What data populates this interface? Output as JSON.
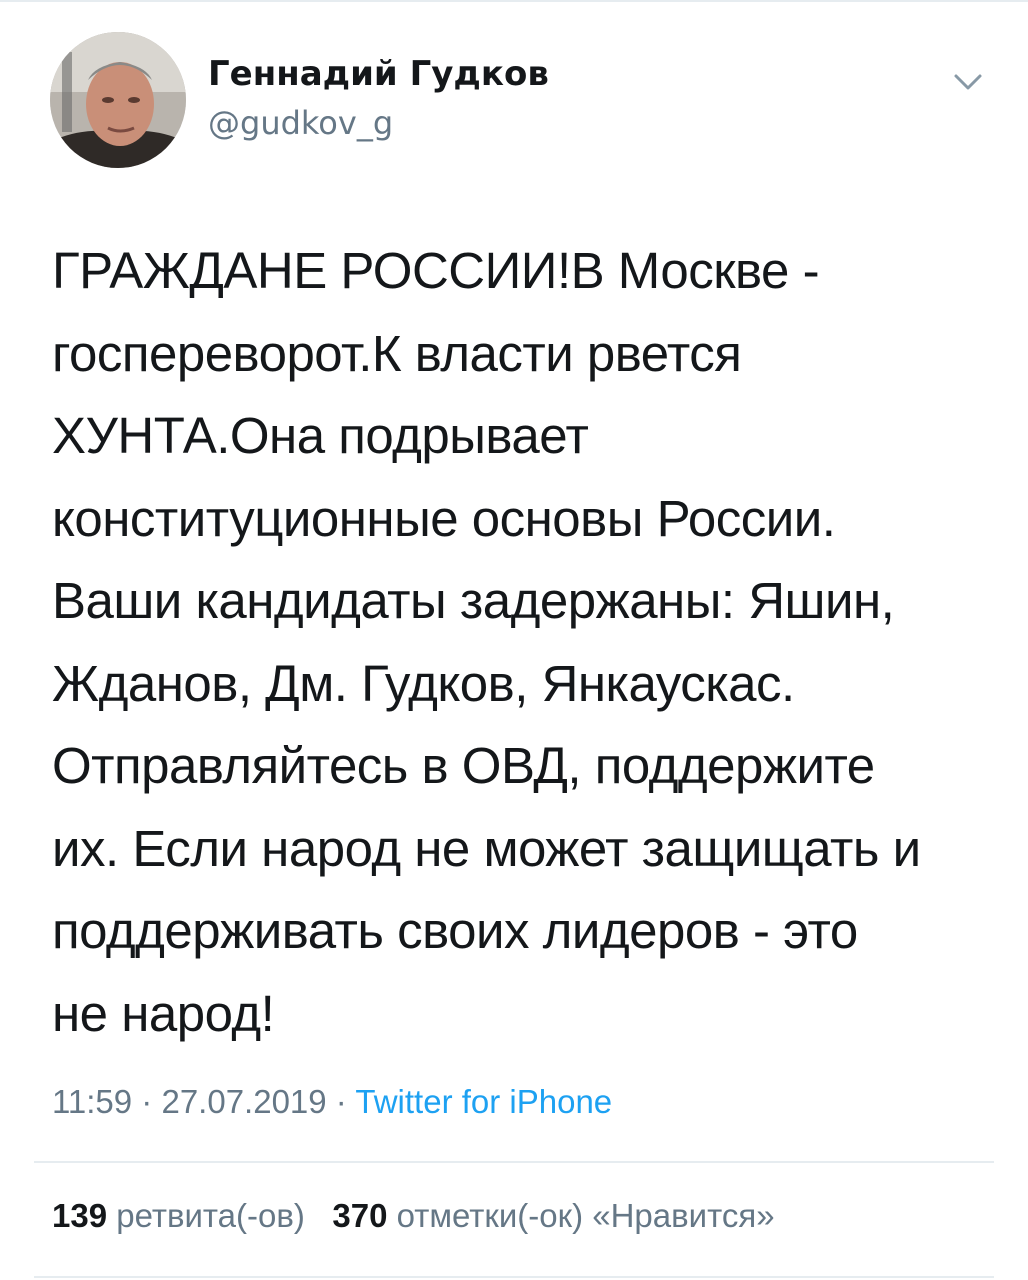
{
  "author": {
    "display_name": "Геннадий Гудков",
    "username": "@gudkov_g"
  },
  "icons": {
    "menu": "chevron-down-icon",
    "avatar": "profile-photo"
  },
  "tweet": {
    "text": "ГРАЖДАНЕ РОССИИ!В Москве -\nгоспереворот.К власти рвется\nХУНТА.Она подрывает\nконституционные основы России.\nВаши кандидаты задержаны: Яшин,\nЖданов, Дм. Гудков, Янкаускас.\nОтправляйтесь в ОВД, поддержите\nих. Если народ не может защищать и\nподдерживать своих лидеров - это\nне народ!",
    "time": "11:59",
    "date": "27.07.2019",
    "separator": " · ",
    "source": "Twitter for iPhone"
  },
  "stats": {
    "retweets_count": "139",
    "retweets_label": "ретвита(-ов)",
    "likes_count": "370",
    "likes_label": "отметки(-ок) «Нравится»"
  },
  "colors": {
    "text": "#14171a",
    "secondary": "#657786",
    "link": "#1da1f2",
    "divider": "#e6ecf0"
  }
}
